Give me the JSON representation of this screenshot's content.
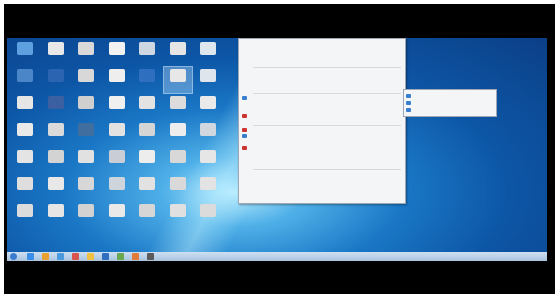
{
  "colors": {
    "frame": "#000000",
    "desktop_accent": "#1a78c6",
    "menu_bg": "#f4f5f7",
    "highlight": "#3a7fcf"
  },
  "desktop_icons": [
    {
      "label": "",
      "color": "#5da0e0"
    },
    {
      "label": "",
      "color": "#e8e8e8"
    },
    {
      "label": "",
      "color": "#d9d9d9"
    },
    {
      "label": "",
      "color": "#f2f2f2"
    },
    {
      "label": "",
      "color": "#cfd8e2"
    },
    {
      "label": "",
      "color": "#e5e5e5"
    },
    {
      "label": "",
      "color": "#e0e6ee"
    },
    {
      "label": "",
      "color": "#4b86c9"
    },
    {
      "label": "",
      "color": "#2b64b0"
    },
    {
      "label": "",
      "color": "#d8d8d8"
    },
    {
      "label": "",
      "color": "#eeeeee"
    },
    {
      "label": "",
      "color": "#2f6fc0"
    },
    {
      "label": "",
      "color": "#e7e7e7"
    },
    {
      "label": "",
      "color": "#dfe5ec"
    },
    {
      "label": "",
      "color": "#e6e6e6"
    },
    {
      "label": "",
      "color": "#3b5fa0"
    },
    {
      "label": "",
      "color": "#cfcfcf"
    },
    {
      "label": "",
      "color": "#f0f0f0"
    },
    {
      "label": "",
      "color": "#e3e3e3"
    },
    {
      "label": "",
      "color": "#dcdcdc"
    },
    {
      "label": "",
      "color": "#eaeaea"
    },
    {
      "label": "",
      "color": "#e9e9e9"
    },
    {
      "label": "",
      "color": "#dadada"
    },
    {
      "label": "",
      "color": "#3f6e9f"
    },
    {
      "label": "",
      "color": "#e2e2e2"
    },
    {
      "label": "",
      "color": "#d5d5d5"
    },
    {
      "label": "",
      "color": "#ededed"
    },
    {
      "label": "",
      "color": "#d0d7df"
    },
    {
      "label": "",
      "color": "#e4e4e4"
    },
    {
      "label": "",
      "color": "#d3d3d3"
    },
    {
      "label": "",
      "color": "#e1e1e1"
    },
    {
      "label": "",
      "color": "#c9ced6"
    },
    {
      "label": "",
      "color": "#ededed"
    },
    {
      "label": "",
      "color": "#d8d8d8"
    },
    {
      "label": "",
      "color": "#e6e6e6"
    },
    {
      "label": "",
      "color": "#dedede"
    },
    {
      "label": "",
      "color": "#e8e8e8"
    },
    {
      "label": "",
      "color": "#d7d7d7"
    },
    {
      "label": "",
      "color": "#cdd4dc"
    },
    {
      "label": "",
      "color": "#e2e2e2"
    },
    {
      "label": "",
      "color": "#d9d9d9"
    },
    {
      "label": "",
      "color": "#e3e3e3"
    },
    {
      "label": "",
      "color": "#dcdcdc"
    },
    {
      "label": "",
      "color": "#e5e5e5"
    },
    {
      "label": "",
      "color": "#d2d2d2"
    },
    {
      "label": "",
      "color": "#e9e9e9"
    },
    {
      "label": "",
      "color": "#d6d6d6"
    },
    {
      "label": "",
      "color": "#e0e0e0"
    },
    {
      "label": "",
      "color": "#dbdbdb"
    }
  ],
  "context_menu": {
    "items": [
      "",
      "",
      "",
      "",
      "",
      "",
      "",
      "",
      "",
      "",
      "",
      "",
      "",
      "",
      "",
      "",
      "",
      "",
      "",
      "",
      "",
      "",
      "",
      "",
      ""
    ],
    "icon_colors": [
      "",
      "",
      "",
      "",
      "",
      "",
      "",
      "",
      "#3a7fcf",
      "",
      "",
      "#c33",
      "",
      "#c33",
      "#3a7fcf",
      "",
      "#c33",
      "",
      "",
      "",
      "",
      "",
      "",
      "",
      ""
    ],
    "separator_after": [
      3,
      7,
      12,
      19
    ]
  },
  "submenu": {
    "items": [
      "",
      "",
      ""
    ]
  },
  "taskbar": {
    "buttons": [
      {
        "color": "#3a8ee8"
      },
      {
        "color": "#e8a030"
      },
      {
        "color": "#4a9ae0"
      },
      {
        "color": "#d9534f"
      },
      {
        "color": "#f0c040"
      },
      {
        "color": "#2f6fc0"
      },
      {
        "color": "#6aa84f"
      },
      {
        "color": "#e07b39"
      },
      {
        "color": "#5a5a5a"
      }
    ],
    "clock": ""
  }
}
